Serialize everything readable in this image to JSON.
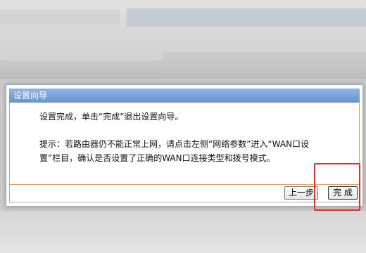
{
  "dialog": {
    "title": "设置向导",
    "message_done": "设置完成，单击“完成”退出设置向导。",
    "tip_line1": "提示：若路由器仍不能正常上网，请点击左侧“网络参数”进入“WAN口设",
    "tip_line2": "置”栏目，确认是否设置了正确的WAN口连接类型和拨号模式。",
    "buttons": {
      "prev_label": "上一步",
      "finish_label": "完 成"
    }
  },
  "colors": {
    "title_bar": "#7aa2d8",
    "frame_border": "#e6a050",
    "highlight_box": "#e0302a"
  }
}
